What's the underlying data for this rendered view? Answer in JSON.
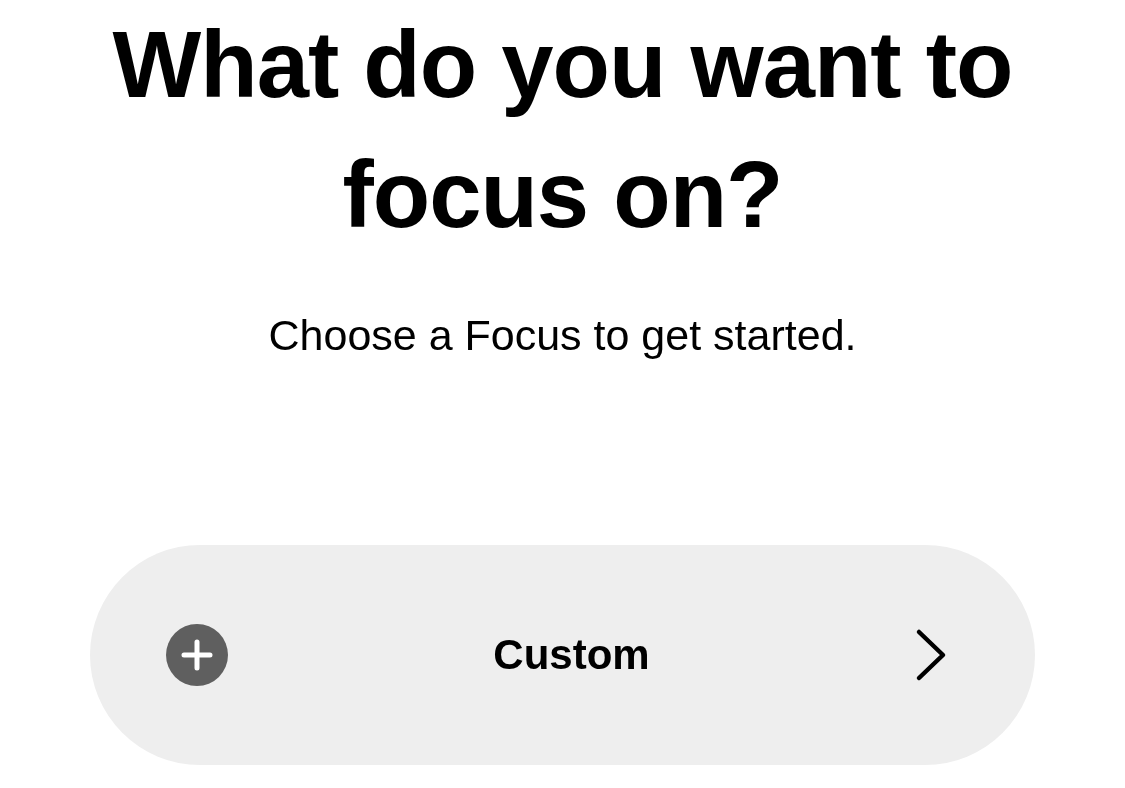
{
  "title": "What do you want to focus on?",
  "subtitle": "Choose a Focus to get started.",
  "option": {
    "label": "Custom"
  }
}
